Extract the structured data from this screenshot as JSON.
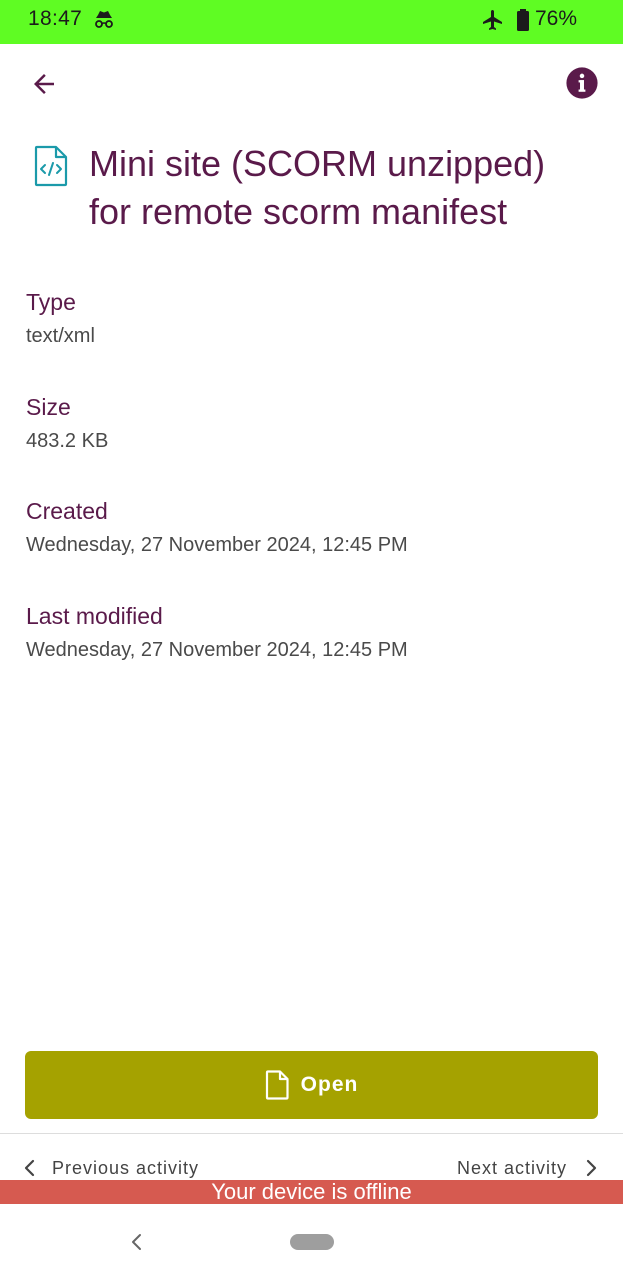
{
  "status_bar": {
    "time": "18:47",
    "battery": "76%",
    "background": "#5ffc23",
    "icons": [
      "incognito-icon",
      "airplane-mode-icon",
      "battery-icon"
    ]
  },
  "header": {
    "back_icon": "arrow-left-icon",
    "info_icon": "info-icon"
  },
  "resource": {
    "icon": "code-file-icon",
    "title": "Mini site (SCORM unzipped) for remote scorm manifest"
  },
  "details": [
    {
      "label": "Type",
      "value": "text/xml"
    },
    {
      "label": "Size",
      "value": "483.2 KB"
    },
    {
      "label": "Created",
      "value": "Wednesday, 27 November 2024, 12:45 PM"
    },
    {
      "label": "Last modified",
      "value": "Wednesday, 27 November 2024, 12:45 PM"
    }
  ],
  "open_button": {
    "label": "Open",
    "icon": "document-icon",
    "color": "#a5a200"
  },
  "activity_nav": {
    "previous": "Previous activity",
    "next": "Next activity"
  },
  "offline_banner": {
    "text": "Your device is offline",
    "color": "#d65a50"
  },
  "colors": {
    "accent": "#5a1a4a",
    "file_icon": "#1b9aaa"
  }
}
